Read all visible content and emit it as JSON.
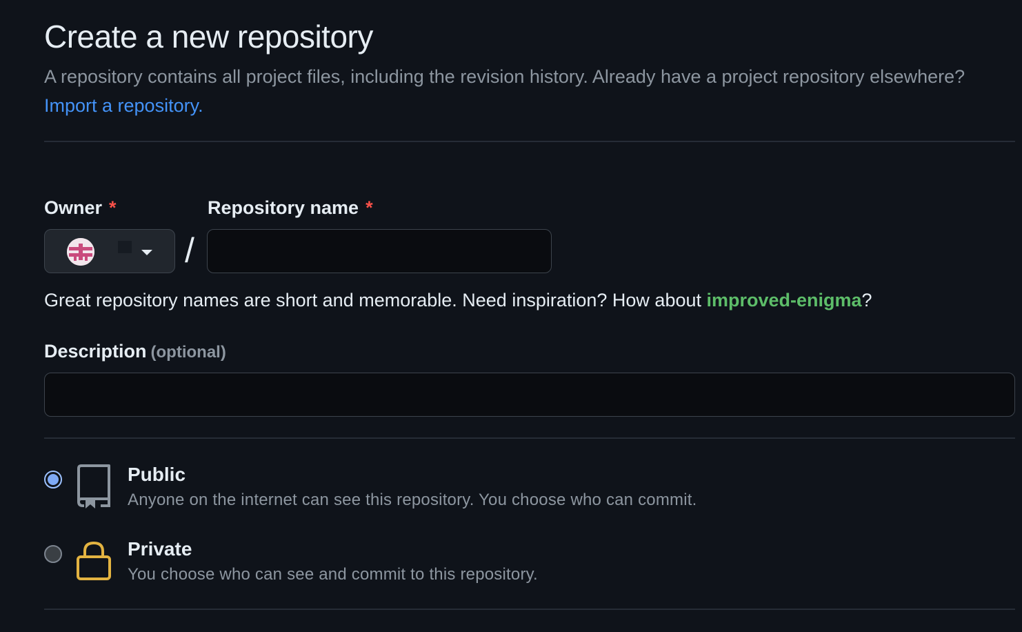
{
  "header": {
    "title": "Create a new repository",
    "subtitle": "A repository contains all project files, including the revision history. Already have a project repository elsewhere?",
    "import_link": "Import a repository."
  },
  "owner": {
    "label": "Owner",
    "required_mark": "*",
    "avatar_icon": "avatar-identicon",
    "dropdown_icon": "caret-down-icon"
  },
  "separator": "/",
  "repo_name": {
    "label": "Repository name",
    "required_mark": "*",
    "value": "",
    "placeholder": ""
  },
  "name_hint": {
    "prefix": "Great repository names are short and memorable. Need inspiration? How about ",
    "suggestion": "improved-enigma",
    "suffix": "?"
  },
  "description": {
    "label": "Description",
    "optional": "(optional)",
    "value": "",
    "placeholder": ""
  },
  "visibility": {
    "options": [
      {
        "title": "Public",
        "description": "Anyone on the internet can see this repository. You choose who can commit.",
        "icon": "repo-icon",
        "selected": true
      },
      {
        "title": "Private",
        "description": "You choose who can see and commit to this repository.",
        "icon": "lock-icon",
        "selected": false
      }
    ]
  },
  "colors": {
    "background": "#0f131a",
    "link": "#4493f8",
    "suggestion": "#5dbd69",
    "required": "#f85149",
    "lock": "#e3b341"
  }
}
